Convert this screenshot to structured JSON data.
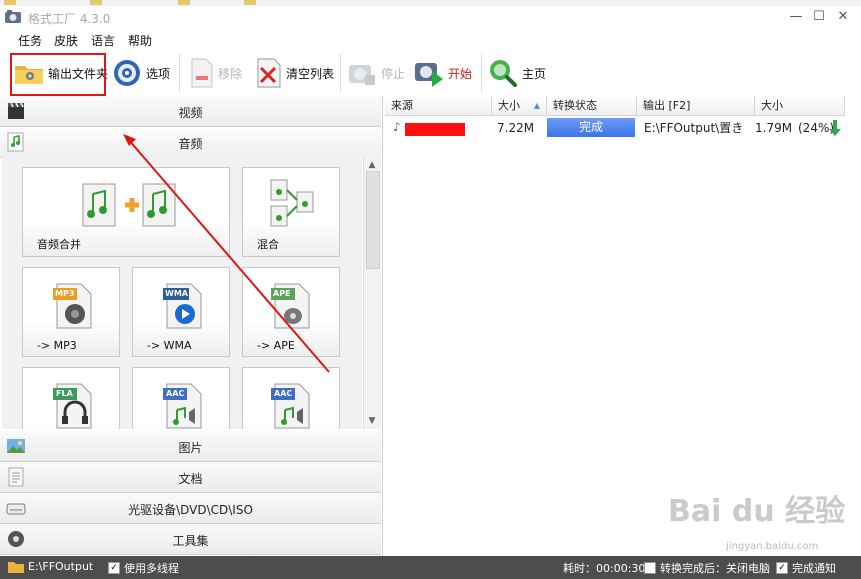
{
  "window": {
    "title": "格式工厂 4.3.0",
    "controls": [
      "—",
      "☐",
      "✕"
    ]
  },
  "menu": [
    "任务",
    "皮肤",
    "语言",
    "帮助"
  ],
  "toolbar": {
    "output_folder": "输出文件夹",
    "options": "选项",
    "remove": "移除",
    "clear_list": "清空列表",
    "stop": "停止",
    "start": "开始",
    "home": "主页"
  },
  "categories": {
    "video": "视频",
    "audio": "音频",
    "picture": "图片",
    "document": "文档",
    "optical": "光驱设备\\DVD\\CD\\ISO",
    "tools": "工具集"
  },
  "tiles": [
    {
      "label": "音频合并",
      "icon": "audio-merge-icon"
    },
    {
      "label": "混合",
      "icon": "audio-mix-icon"
    },
    {
      "label": "-> MP3",
      "icon": "mp3-file-icon",
      "badge": "MP3"
    },
    {
      "label": "-> WMA",
      "icon": "wma-file-icon",
      "badge": "WMA"
    },
    {
      "label": "-> APE",
      "icon": "ape-file-icon",
      "badge": "APE"
    },
    {
      "label": "",
      "icon": "fla-file-icon",
      "badge": "FLA"
    },
    {
      "label": "",
      "icon": "aac-file-icon",
      "badge": "AAC"
    },
    {
      "label": "",
      "icon": "aac-file-icon",
      "badge": "AAC"
    }
  ],
  "task_table": {
    "columns": [
      "来源",
      "大小",
      "转换状态",
      "输出 [F2]",
      "大小"
    ],
    "rows": [
      {
        "size": "7.22M",
        "status": "完成",
        "output": "E:\\FFOutput\\置き",
        "out_size": "1.79M",
        "ratio": "(24%)"
      }
    ]
  },
  "statusbar": {
    "output_path": "E:\\FFOutput",
    "multithread": "使用多线程",
    "elapsed": "耗时：00:00:30",
    "after_done": "转换完成后：关闭电脑",
    "notify": "完成通知"
  },
  "watermark": {
    "main": "Bai du 经验",
    "sub": "jingyan.baidu.com"
  },
  "colors": {
    "highlight": "#e01515",
    "status_done": "#3c74e8",
    "statusbar_bg": "#4d4d4d"
  }
}
